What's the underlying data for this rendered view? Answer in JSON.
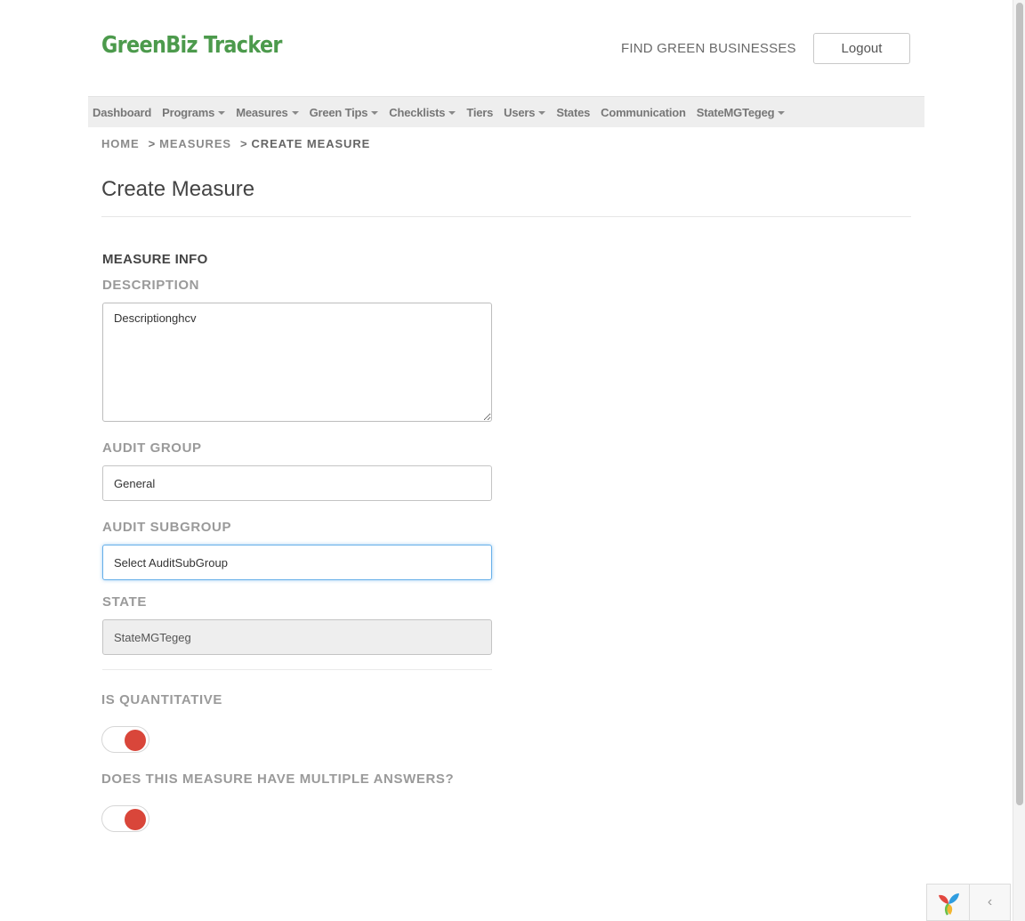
{
  "header": {
    "brand": "GreenBiz Tracker",
    "find_link": "FIND GREEN BUSINESSES",
    "logout_label": "Logout"
  },
  "nav": {
    "items": [
      {
        "label": "Dashboard",
        "dropdown": false
      },
      {
        "label": "Programs",
        "dropdown": true
      },
      {
        "label": "Measures",
        "dropdown": true
      },
      {
        "label": "Green Tips",
        "dropdown": true
      },
      {
        "label": "Checklists",
        "dropdown": true
      },
      {
        "label": "Tiers",
        "dropdown": false
      },
      {
        "label": "Users",
        "dropdown": true
      },
      {
        "label": "States",
        "dropdown": false
      },
      {
        "label": "Communication",
        "dropdown": false
      },
      {
        "label": "StateMGTegeg",
        "dropdown": true
      }
    ]
  },
  "breadcrumb": {
    "home": "HOME",
    "measures": "MEASURES",
    "current": "CREATE MEASURE",
    "sep": ">"
  },
  "page": {
    "title": "Create Measure"
  },
  "form": {
    "section_title": "MEASURE INFO",
    "description": {
      "label": "DESCRIPTION",
      "value": "Descriptionghcv"
    },
    "audit_group": {
      "label": "AUDIT GROUP",
      "value": "General"
    },
    "audit_subgroup": {
      "label": "AUDIT SUBGROUP",
      "value": "Select AuditSubGroup"
    },
    "state": {
      "label": "STATE",
      "value": "StateMGTegeg"
    },
    "is_quantitative": {
      "label": "IS QUANTITATIVE",
      "on": true
    },
    "multiple_answers": {
      "label": "DOES THIS MEASURE HAVE MULTIPLE ANSWERS?",
      "on": true
    }
  },
  "colors": {
    "brand_green": "#4c9a4c",
    "toggle_on": "#d9463a",
    "focus_border": "#66afe9"
  },
  "icons": {
    "corner_logo": "yii-logo-icon",
    "corner_arrow": "chevron-left-icon"
  }
}
